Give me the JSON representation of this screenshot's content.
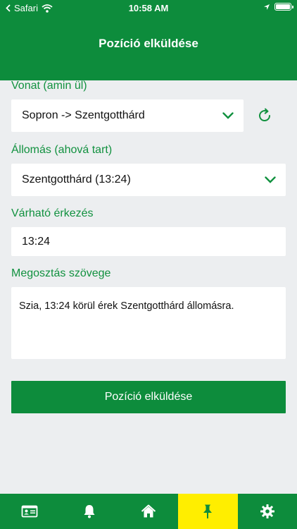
{
  "statusbar": {
    "carrier": "Safari",
    "time": "10:58 AM"
  },
  "header": {
    "title": "Pozíció elküldése"
  },
  "form": {
    "train": {
      "label": "Vonat (amin ül)",
      "value": "Sopron -> Szentgotthárd"
    },
    "station": {
      "label": "Állomás (ahová tart)",
      "value": "Szentgotthárd (13:24)"
    },
    "arrival": {
      "label": "Várható érkezés",
      "value": "13:24"
    },
    "share_text": {
      "label": "Megosztás szövege",
      "value": "Szia, 13:24  körül érek Szentgotthárd állomásra."
    },
    "submit_label": "Pozíció elküldése"
  },
  "tabbar": {
    "tabs": [
      {
        "icon": "id-card-icon",
        "active": false
      },
      {
        "icon": "bell-icon",
        "active": false
      },
      {
        "icon": "home-icon",
        "active": false
      },
      {
        "icon": "pin-icon",
        "active": true
      },
      {
        "icon": "gear-icon",
        "active": false
      }
    ]
  },
  "colors": {
    "primary": "#0d8c3c",
    "label": "#11913f",
    "background": "#eceef0",
    "active_tab": "#ffee00"
  }
}
